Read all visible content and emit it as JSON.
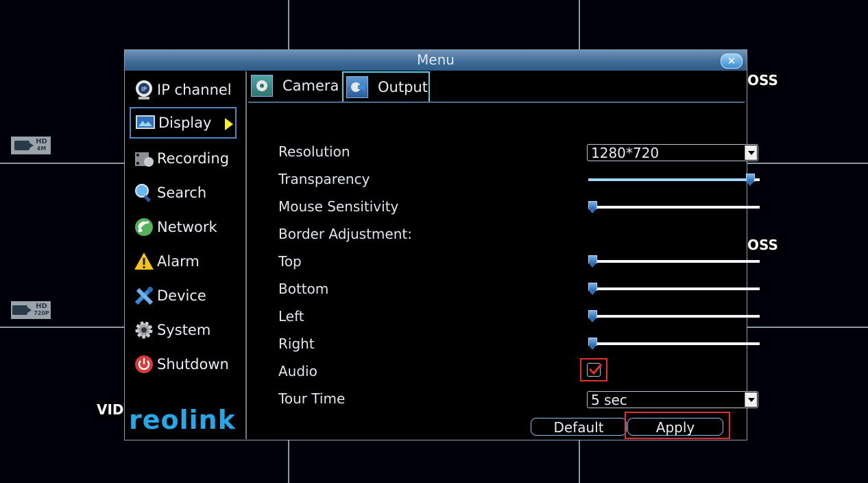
{
  "background": {
    "cam_badge_top": {
      "line1": "HD",
      "line2": "4M"
    },
    "cam_badge_bottom": {
      "line1": "HD",
      "line2": "720P"
    },
    "right_label_top": "OSS",
    "right_label_mid": "OSS",
    "left_label": "VID"
  },
  "window": {
    "title": "Menu",
    "close_icon": "close-icon",
    "close_glyph": "✕"
  },
  "sidebar": {
    "items": [
      {
        "label": "IP channel",
        "icon": "ip-camera-icon"
      },
      {
        "label": "Display",
        "icon": "display-icon",
        "active": true
      },
      {
        "label": "Recording",
        "icon": "recording-icon"
      },
      {
        "label": "Search",
        "icon": "search-icon"
      },
      {
        "label": "Network",
        "icon": "network-icon"
      },
      {
        "label": "Alarm",
        "icon": "alarm-icon"
      },
      {
        "label": "Device",
        "icon": "device-icon"
      },
      {
        "label": "System",
        "icon": "gear-icon"
      },
      {
        "label": "Shutdown",
        "icon": "power-icon"
      }
    ],
    "logo": "reolink"
  },
  "tabs": [
    {
      "label": "Camera",
      "icon": "camera-settings-icon"
    },
    {
      "label": "Output",
      "icon": "output-settings-icon",
      "active": true
    }
  ],
  "form": {
    "resolution": {
      "label": "Resolution",
      "value": "1280*720"
    },
    "transparency": {
      "label": "Transparency",
      "level": 0.97
    },
    "mouse_sensitivity": {
      "label": "Mouse Sensitivity",
      "level": 0.0
    },
    "border_adjustment": {
      "label": "Border Adjustment:"
    },
    "top": {
      "label": "Top",
      "level": 0.0
    },
    "bottom": {
      "label": "Bottom",
      "level": 0.0
    },
    "left": {
      "label": "Left",
      "level": 0.0
    },
    "right": {
      "label": "Right",
      "level": 0.0
    },
    "audio": {
      "label": "Audio",
      "checked": true
    },
    "tour_time": {
      "label": "Tour Time",
      "value": "5 sec"
    }
  },
  "buttons": {
    "default": "Default",
    "apply": "Apply"
  },
  "colors": {
    "accent": "#27a7e6",
    "highlight": "#e0312e",
    "arrow": "#f4ef2a"
  }
}
